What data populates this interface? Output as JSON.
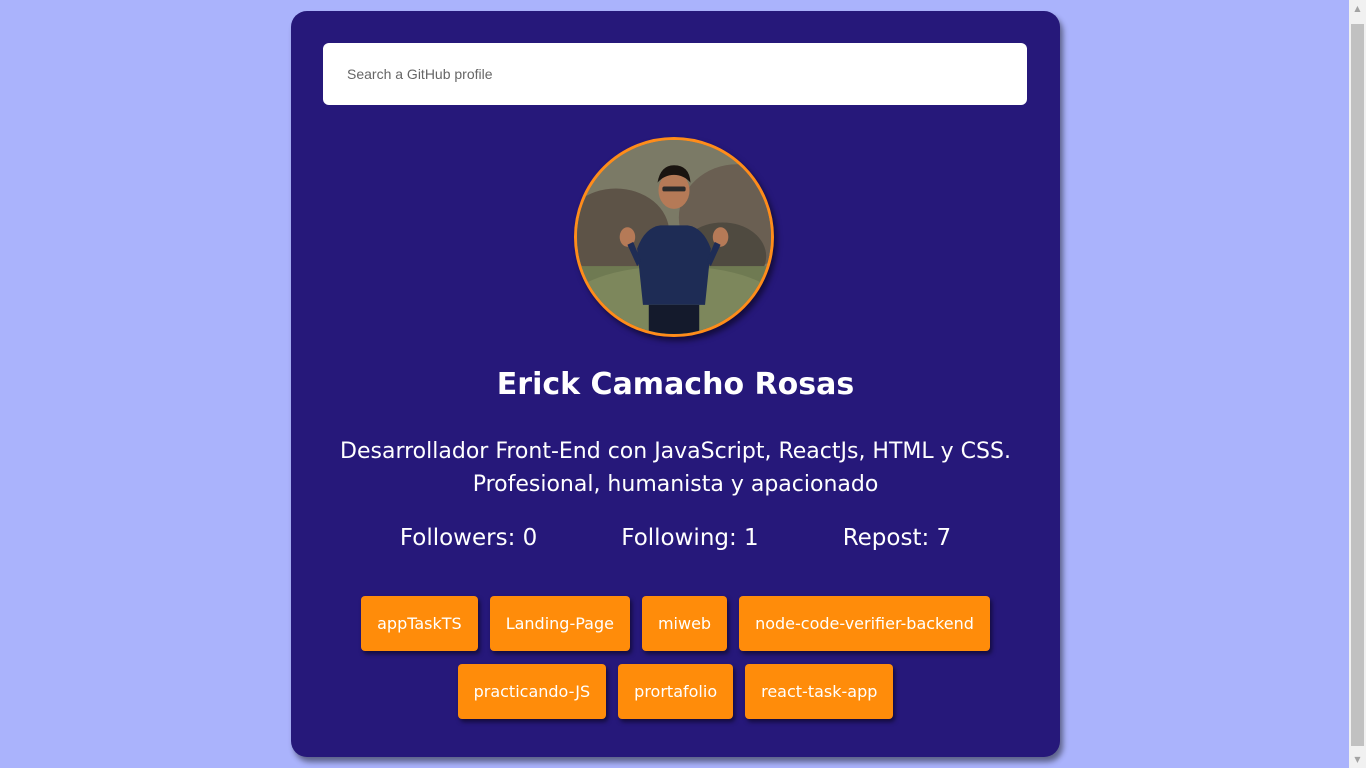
{
  "search": {
    "placeholder": "Search a GitHub profile",
    "value": ""
  },
  "profile": {
    "name": "Erick Camacho Rosas",
    "bio": "Desarrollador Front-End con JavaScript, ReactJs, HTML y CSS. Profesional, humanista y apacionado",
    "avatar_alt": "avatar-photo"
  },
  "stats": {
    "followers": "Followers: 0",
    "following": "Following: 1",
    "repost": "Repost: 7"
  },
  "repos": [
    "appTaskTS",
    "Landing-Page",
    "miweb",
    "node-code-verifier-backend",
    "practicando-JS",
    "prortafolio",
    "react-task-app"
  ],
  "colors": {
    "page_bg": "#aab3fc",
    "card_bg": "#26187a",
    "accent": "#ff8c0a"
  }
}
